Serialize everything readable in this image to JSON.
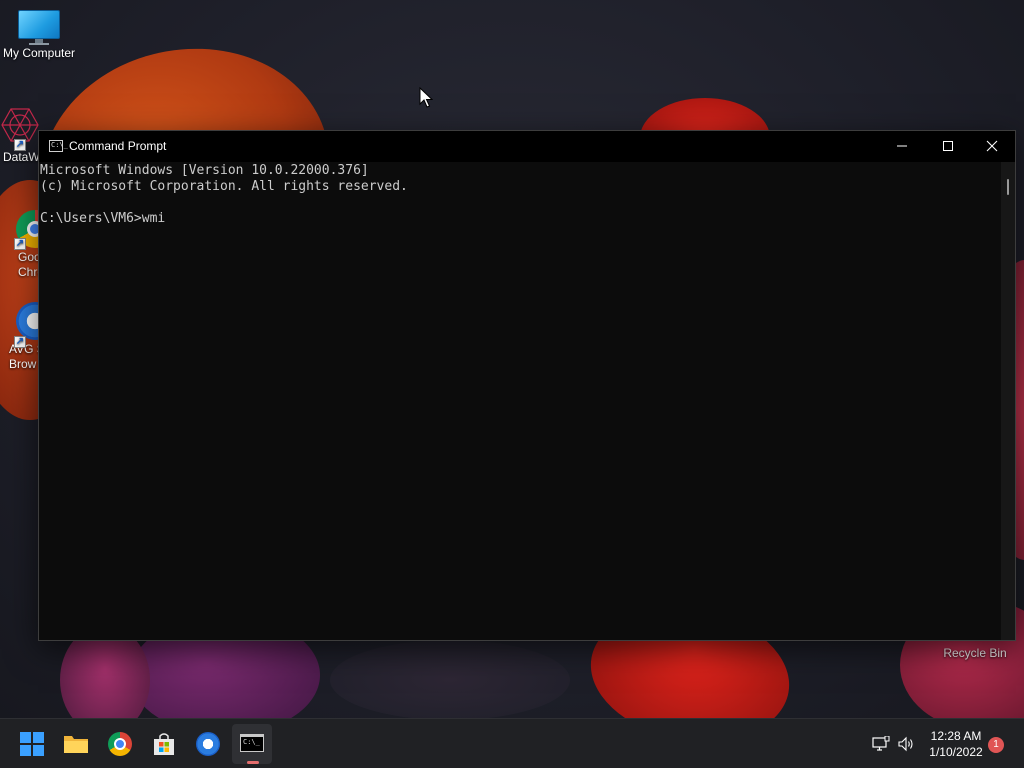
{
  "desktop": {
    "icons": [
      {
        "label": "My Computer"
      },
      {
        "label": "DataW"
      },
      {
        "label": "Goo\nChro"
      },
      {
        "label": "AVG S\nBrow"
      }
    ],
    "recycle_bin": "Recycle Bin"
  },
  "cmd": {
    "title": "Command Prompt",
    "icon_glyph": "C:\\_",
    "lines": [
      "Microsoft Windows [Version 10.0.22000.376]",
      "(c) Microsoft Corporation. All rights reserved.",
      "",
      "C:\\Users\\VM6>wmi"
    ]
  },
  "taskbar": {
    "pinned": [
      "start-icon",
      "file-explorer-icon",
      "chrome-icon",
      "microsoft-store-icon",
      "avg-browser-icon",
      "command-prompt-icon"
    ],
    "active": "command-prompt-icon",
    "clock_time": "12:28 AM",
    "clock_date": "1/10/2022",
    "notification_count": "1"
  },
  "colors": {
    "taskbar_bg": "#202124",
    "console_bg": "#0c0c0c",
    "console_fg": "#cccccc",
    "accent_blue": "#1e9be0"
  }
}
